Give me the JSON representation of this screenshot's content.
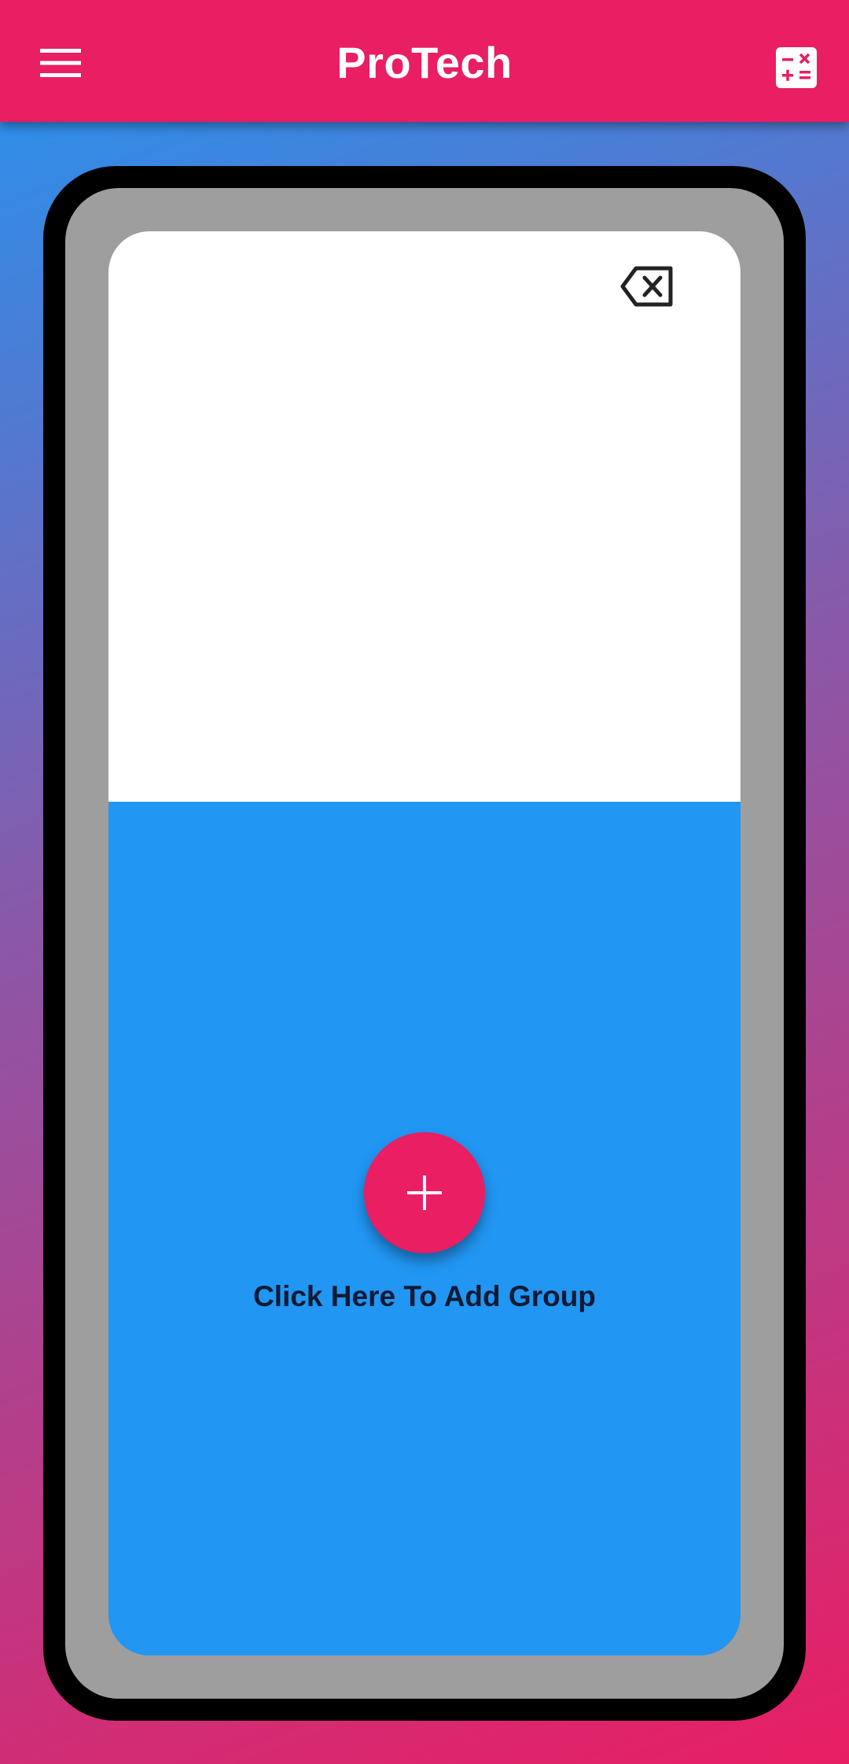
{
  "app_bar": {
    "title": "ProTech",
    "menu_icon": "hamburger-menu-icon",
    "calculator_icon": "calculator-icon"
  },
  "screen": {
    "backspace_icon": "backspace-icon",
    "display_value": "",
    "add_button_icon": "plus-icon",
    "add_group_label": "Click Here To Add Group"
  },
  "colors": {
    "primary": "#e91e63",
    "accent_blue": "#2196f3",
    "bezel_gray": "#9e9e9e",
    "frame_black": "#000000",
    "label_text": "#111a33"
  }
}
